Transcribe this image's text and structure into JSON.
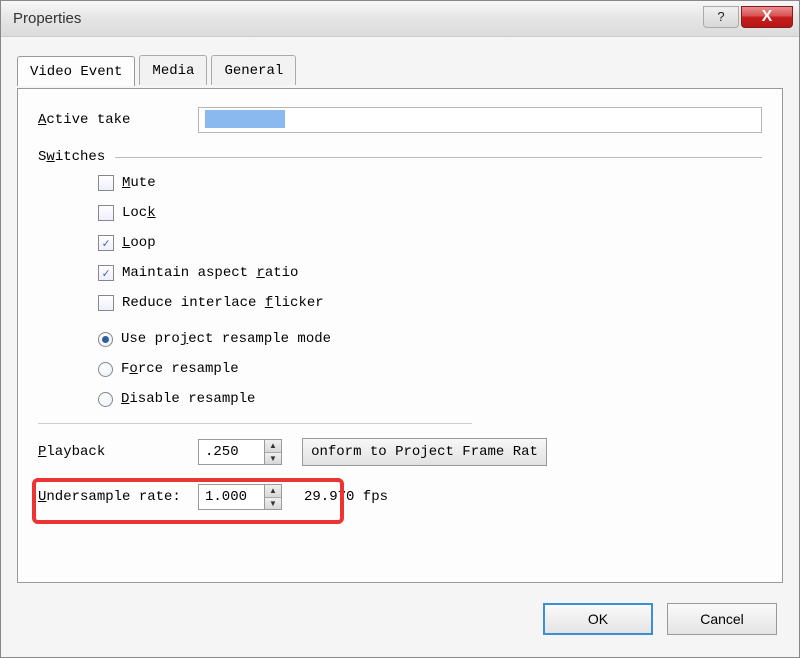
{
  "window": {
    "title": "Properties",
    "help": "?",
    "close": "X"
  },
  "tabs": [
    {
      "label": "Video Event",
      "active": true
    },
    {
      "label": "Media",
      "active": false
    },
    {
      "label": "General",
      "active": false
    }
  ],
  "active_take": {
    "label": "Active take",
    "value": ""
  },
  "switches": {
    "label": "Switches",
    "items": [
      {
        "label": "Mute",
        "checked": false
      },
      {
        "label": "Lock",
        "checked": false
      },
      {
        "label": "Loop",
        "checked": true
      },
      {
        "label": "Maintain aspect ratio",
        "checked": true
      },
      {
        "label": "Reduce interlace flicker",
        "checked": false
      }
    ]
  },
  "resample": {
    "options": [
      {
        "label": "Use project resample mode",
        "checked": true
      },
      {
        "label": "Force resample",
        "checked": false
      },
      {
        "label": "Disable resample",
        "checked": false
      }
    ]
  },
  "playback": {
    "label": "Playback",
    "value": ".250",
    "conform_btn": "onform to Project Frame Rat"
  },
  "undersample": {
    "label": "Undersample rate:",
    "value": "1.000",
    "fps": "29.970 fps"
  },
  "footer": {
    "ok": "OK",
    "cancel": "Cancel"
  }
}
